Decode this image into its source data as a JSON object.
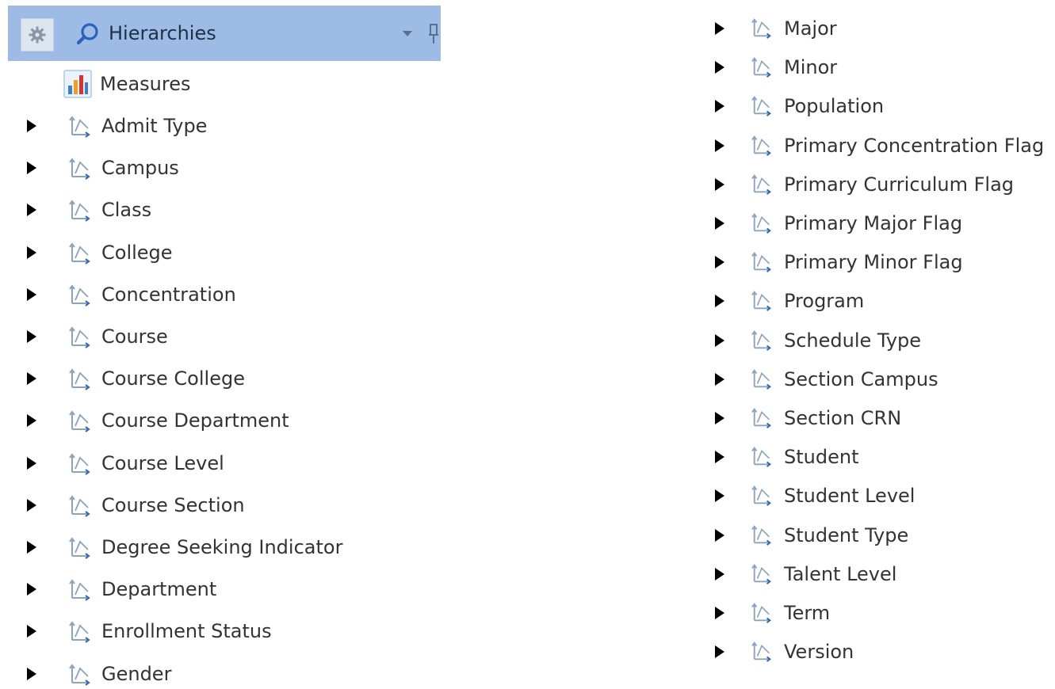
{
  "header": {
    "title": "Hierarchies",
    "icons": {
      "settings": "gear-icon",
      "search": "search-icon",
      "dropdown": "chevron-down-icon",
      "pin": "pin-icon"
    },
    "background": "#9dbbe4"
  },
  "measures": {
    "label": "Measures",
    "icon": "measures-icon"
  },
  "hierarchy_icon": "hierarchy-icon",
  "left_items": [
    "Admit Type",
    "Campus",
    "Class",
    "College",
    "Concentration",
    "Course",
    "Course College",
    "Course Department",
    "Course Level",
    "Course Section",
    "Degree Seeking Indicator",
    "Department",
    "Enrollment Status",
    "Gender"
  ],
  "right_items": [
    "Major",
    "Minor",
    "Population",
    "Primary Concentration Flag",
    "Primary Curriculum Flag",
    "Primary Major Flag",
    "Primary Minor Flag",
    "Program",
    "Schedule Type",
    "Section Campus",
    "Section CRN",
    "Student",
    "Student Level",
    "Student Type",
    "Talent Level",
    "Term",
    "Version"
  ]
}
